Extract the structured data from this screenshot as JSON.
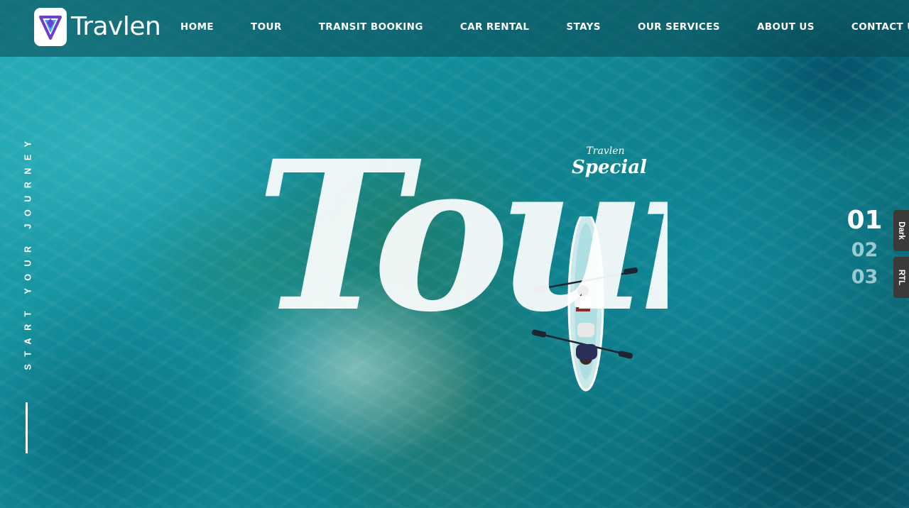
{
  "header": {
    "brand": "Travlen",
    "nav": [
      "HOME",
      "TOUR",
      "TRANSIT BOOKING",
      "CAR RENTAL",
      "STAYS",
      "OUR SERVICES",
      "ABOUT US",
      "CONTACT US"
    ]
  },
  "hero": {
    "side_text": "START YOUR JOURNEY",
    "headline": "Tour",
    "badge": {
      "brand": "Travlen",
      "label": "Special"
    }
  },
  "slider": {
    "numbers": [
      "01",
      "02",
      "03"
    ],
    "active_index": 0
  },
  "side_tabs": {
    "dark": "Dark",
    "rtl": "RTL"
  },
  "colors": {
    "brand_purple": "#6b3fd1",
    "brand_blue": "#3fa9f5",
    "water": "#138d9a",
    "tab_bg": "#3a3a3a"
  }
}
